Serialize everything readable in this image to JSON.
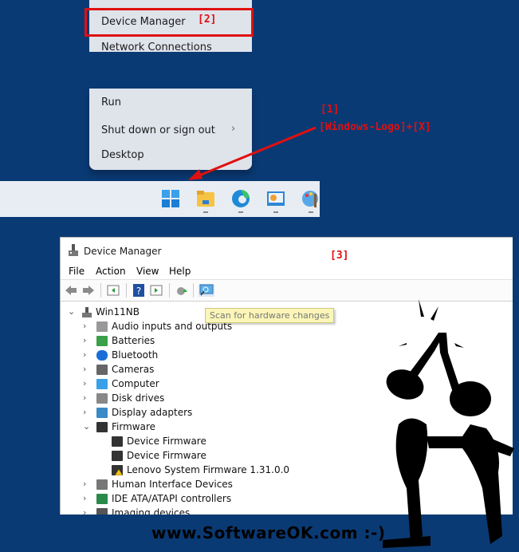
{
  "context_menu": {
    "items_top": [
      "Device Manager",
      "Network Connections"
    ],
    "items_bottom": [
      "Run",
      "Shut down or sign out",
      "Desktop"
    ],
    "submenu_chevron": "›"
  },
  "annotations": {
    "step1": "[1]",
    "step1_hint": "[Windows-Logo]+[X]",
    "step2": "[2]",
    "step3": "[3]",
    "color": "#e01010"
  },
  "taskbar": {
    "icons": [
      "windows-start-icon",
      "file-explorer-icon",
      "edge-icon",
      "control-panel-icon",
      "paint-icon"
    ]
  },
  "device_manager": {
    "title": "Device Manager",
    "menu": [
      "File",
      "Action",
      "View",
      "Help"
    ],
    "toolbar": [
      "back",
      "forward",
      "show-hide-console-tree",
      "help",
      "properties",
      "update-driver",
      "scan-for-hardware-changes"
    ],
    "tooltip": "Scan for hardware changes",
    "root": "Win11NB",
    "tree": [
      {
        "label": "Audio inputs and outputs",
        "level": 1,
        "expanded": false,
        "icon": "speaker-icon"
      },
      {
        "label": "Batteries",
        "level": 1,
        "expanded": false,
        "icon": "battery-icon"
      },
      {
        "label": "Bluetooth",
        "level": 1,
        "expanded": false,
        "icon": "bluetooth-icon"
      },
      {
        "label": "Cameras",
        "level": 1,
        "expanded": false,
        "icon": "camera-icon"
      },
      {
        "label": "Computer",
        "level": 1,
        "expanded": false,
        "icon": "monitor-icon"
      },
      {
        "label": "Disk drives",
        "level": 1,
        "expanded": false,
        "icon": "disk-icon"
      },
      {
        "label": "Display adapters",
        "level": 1,
        "expanded": false,
        "icon": "display-adapter-icon"
      },
      {
        "label": "Firmware",
        "level": 1,
        "expanded": true,
        "icon": "chip-icon"
      },
      {
        "label": "Device Firmware",
        "level": 2,
        "icon": "chip-icon"
      },
      {
        "label": "Device Firmware",
        "level": 2,
        "icon": "chip-icon"
      },
      {
        "label": "Lenovo System Firmware 1.31.0.0",
        "level": 2,
        "icon": "chip-warning-icon"
      },
      {
        "label": "Human Interface Devices",
        "level": 1,
        "expanded": false,
        "icon": "keyboard-icon"
      },
      {
        "label": "IDE ATA/ATAPI controllers",
        "level": 1,
        "expanded": false,
        "icon": "controller-icon"
      },
      {
        "label": "Imaging devices",
        "level": 1,
        "expanded": false,
        "icon": "scanner-icon"
      }
    ]
  },
  "watermark": "www.SoftwareOK.com :-)"
}
